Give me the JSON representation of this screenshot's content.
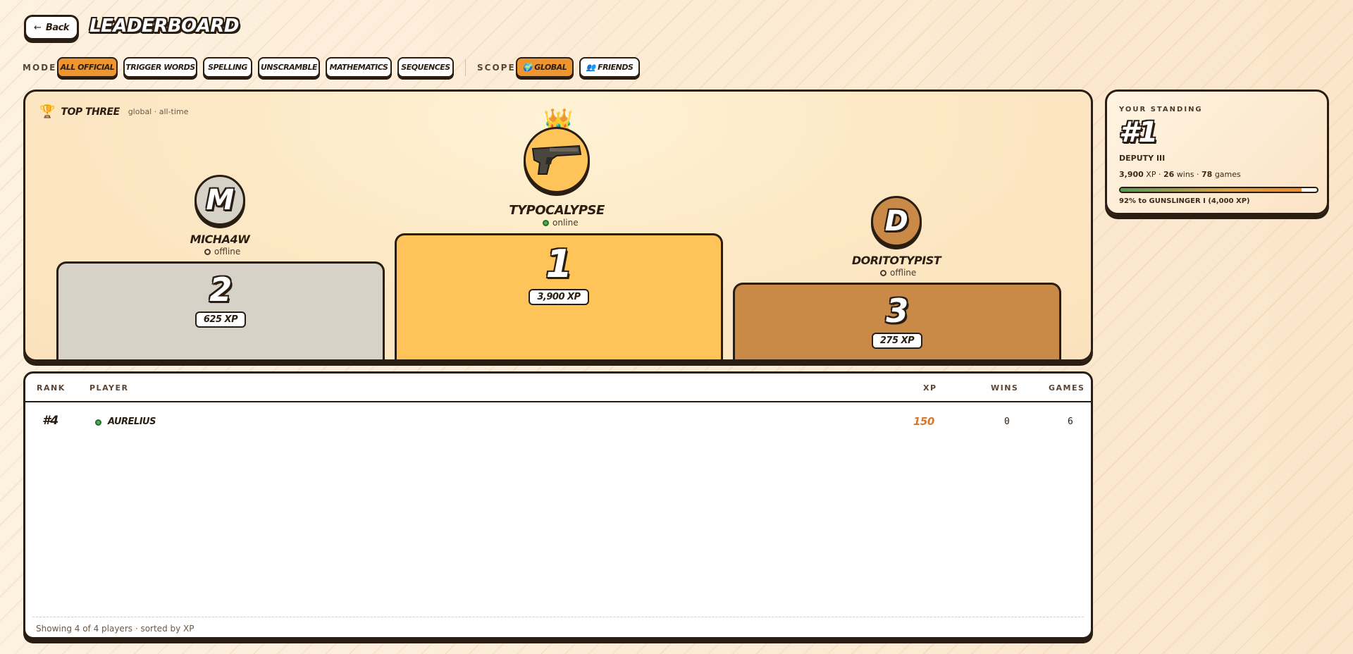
{
  "header": {
    "back_label": "Back",
    "title": "LEADERBOARD"
  },
  "filters": {
    "mode_label": "MODE",
    "modes": [
      "All Official",
      "Trigger Words",
      "Spelling",
      "Unscramble",
      "Mathematics",
      "Sequences"
    ],
    "active_mode": "All Official",
    "scope_label": "SCOPE",
    "scopes": [
      "🌍 Global",
      "👥 Friends"
    ],
    "active_scope": "🌍 Global"
  },
  "podium": {
    "title": "TOP THREE",
    "subtitle": "global · all-time",
    "first": {
      "rank": "1",
      "name": "TYPOCALYPSE",
      "status": "online",
      "xp": "3,900 XP",
      "avatar_icon": "pistol-icon",
      "crown": "👑"
    },
    "second": {
      "rank": "2",
      "name": "MICHA4W",
      "status": "offline",
      "xp": "625 XP",
      "avatar_letter": "M"
    },
    "third": {
      "rank": "3",
      "name": "DORITOTYPIST",
      "status": "offline",
      "xp": "275 XP",
      "avatar_letter": "D"
    },
    "colors": {
      "gold": "#fec45a",
      "silver": "#d6d2c8",
      "bronze": "#c98a48"
    }
  },
  "table": {
    "columns": {
      "rank": "RANK",
      "player": "PLAYER",
      "xp": "XP",
      "wins": "WINS",
      "games": "GAMES"
    },
    "rows": [
      {
        "rank": "#4",
        "player": "AURELIUS",
        "status": "online",
        "xp": "150",
        "wins": "0",
        "games": "6"
      }
    ],
    "footer": "Showing 4 of 4 players · sorted by XP"
  },
  "standing": {
    "label": "YOUR STANDING",
    "rank": "#1",
    "tier": "DEPUTY III",
    "xp": "3,900",
    "xp_unit": " XP · ",
    "wins": "26",
    "wins_unit": " wins · ",
    "games": "78",
    "games_unit": " games",
    "progress_pct": 92,
    "next_text": "92% to GUNSLINGER I (4,000 XP)"
  }
}
